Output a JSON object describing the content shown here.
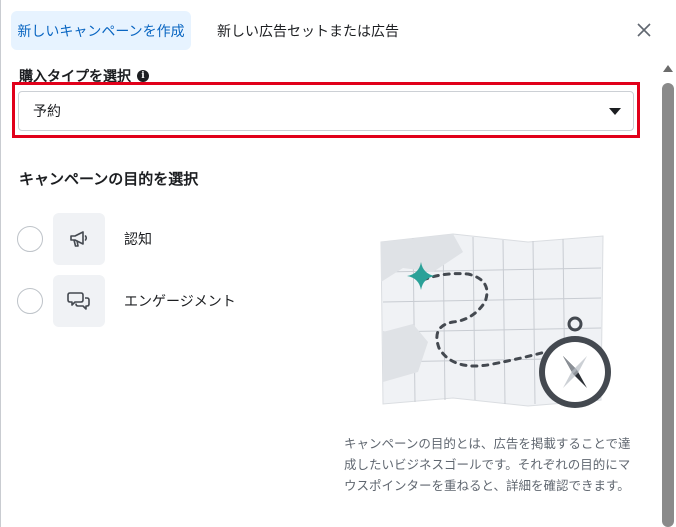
{
  "tabs": {
    "active_label": "新しいキャンペーンを作成",
    "inactive_label": "新しい広告セットまたは広告"
  },
  "close_icon": "close-icon",
  "purchase_type": {
    "label": "購入タイプを選択",
    "info_glyph": "i",
    "selected_value": "予約"
  },
  "objective": {
    "title": "キャンペーンの目的を選択",
    "options": [
      {
        "label": "認知",
        "icon": "megaphone-icon"
      },
      {
        "label": "エンゲージメント",
        "icon": "chat-bubbles-icon"
      }
    ],
    "description": "キャンペーンの目的とは、広告を掲載することで達成したいビジネスゴールです。それぞれの目的にマウスポインターを重ねると、詳細を確認できます。"
  },
  "colors": {
    "accent": "#0a66c2",
    "active_tab_bg": "#e7f3ff",
    "highlight": "#e1001a",
    "map_star": "#2aa198"
  }
}
